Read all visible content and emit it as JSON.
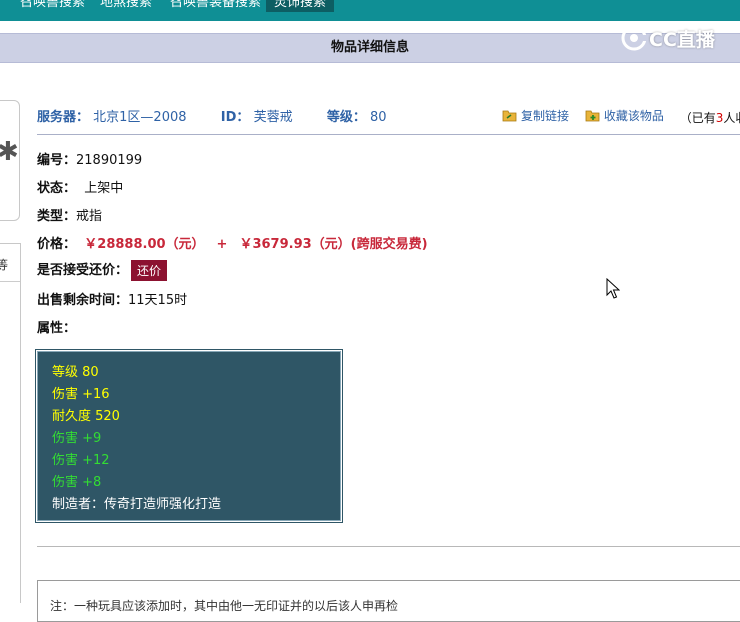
{
  "top_nav": {
    "tabs": [
      {
        "label": "召唤兽搜索"
      },
      {
        "label": "地煞搜索"
      },
      {
        "label": "召唤兽装备搜索"
      },
      {
        "label": "灵饰搜索"
      }
    ]
  },
  "watermark": {
    "text": "CC直播"
  },
  "title": "物品详细信息",
  "info": {
    "server_label": "服务器：",
    "server_value": "北京1区—2008",
    "id_label": "ID：",
    "id_value": "芙蓉戒",
    "level_label": "等级：",
    "level_value": "80"
  },
  "actions": {
    "copy_link": "复制链接",
    "favorite": "收藏该物品",
    "note_prefix": "（已有",
    "note_count": "3",
    "note_suffix": "人收藏"
  },
  "details": {
    "number_label": "编号：",
    "number_value": "21890199",
    "status_label": "状态：",
    "status_value": "上架中",
    "type_label": "类型：",
    "type_value": "戒指",
    "price_label": "价格：",
    "price_main": "￥28888.00（元）",
    "price_plus": "+",
    "price_fee": "￥3679.93（元）(跨服交易费)",
    "bargain_label": "是否接受还价：",
    "bargain_button": "还价",
    "time_label": "出售剩余时间：",
    "time_value": "11天15时",
    "attr_label": "属性："
  },
  "attributes": [
    {
      "text": "等级 80",
      "color": "#ffff00"
    },
    {
      "text": "伤害 +16",
      "color": "#ffff00"
    },
    {
      "text": "耐久度 520",
      "color": "#ffff00"
    },
    {
      "text": "伤害 +9",
      "color": "#33dd33"
    },
    {
      "text": "伤害 +12",
      "color": "#33dd33"
    },
    {
      "text": "伤害 +8",
      "color": "#33dd33"
    },
    {
      "text": "制造者：传奇打造师强化打造",
      "color": "#ffffff"
    }
  ],
  "left_fragment": {
    "tab_text": "等"
  },
  "bottom_note": "注：一种玩具应该添加时，其中由他一无印证并的以后该人申再检"
}
